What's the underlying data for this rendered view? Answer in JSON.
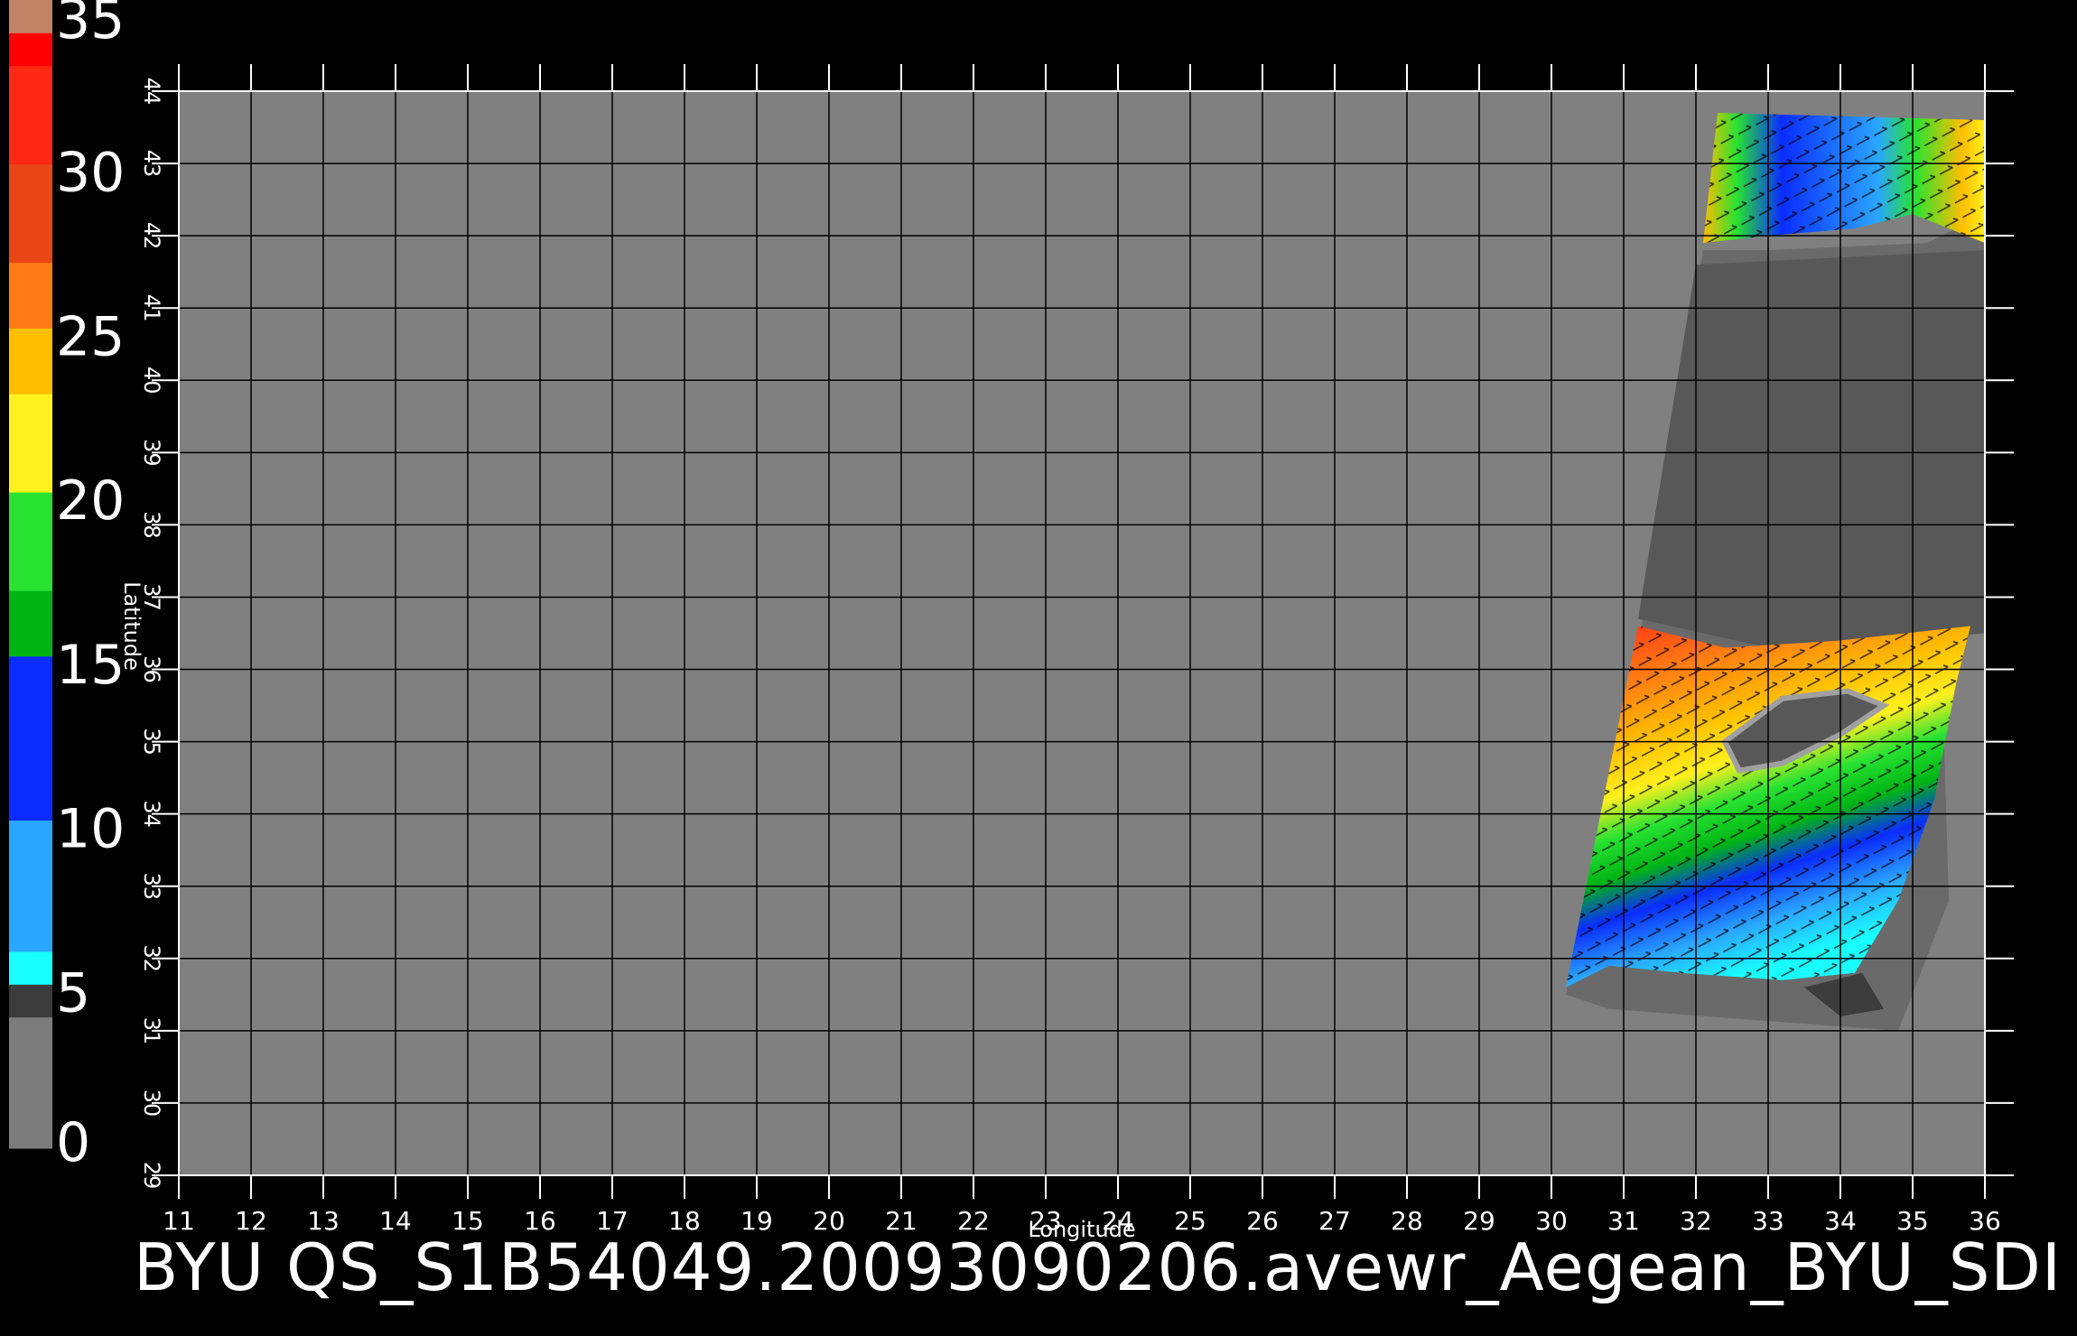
{
  "footer": {
    "title": "BYU  QS_S1B54049.20093090206.avewr_Aegean_BYU_SDI"
  },
  "chart_data": {
    "type": "heatmap",
    "xlabel": "Longitude",
    "ylabel": "Latitude",
    "xlim": [
      11,
      36
    ],
    "ylim": [
      29,
      44
    ],
    "xticks": [
      11,
      12,
      13,
      14,
      15,
      16,
      17,
      18,
      19,
      20,
      21,
      22,
      23,
      24,
      25,
      26,
      27,
      28,
      29,
      30,
      31,
      32,
      33,
      34,
      35,
      36
    ],
    "yticks": [
      29,
      30,
      31,
      32,
      33,
      34,
      35,
      36,
      37,
      38,
      39,
      40,
      41,
      42,
      43,
      44
    ],
    "grid": true,
    "colorbar": {
      "ticks": [
        0,
        5,
        10,
        15,
        20,
        25,
        30,
        35
      ],
      "range": [
        0,
        35
      ],
      "bands": [
        {
          "from": 0,
          "to": 4,
          "color": "#7c7c7c"
        },
        {
          "from": 4,
          "to": 5,
          "color": "#3c3c3c"
        },
        {
          "from": 5,
          "to": 6,
          "color": "#19ffff"
        },
        {
          "from": 6,
          "to": 10,
          "color": "#2aa6ff"
        },
        {
          "from": 10,
          "to": 15,
          "color": "#0a2cff"
        },
        {
          "from": 15,
          "to": 17,
          "color": "#00b414"
        },
        {
          "from": 17,
          "to": 20,
          "color": "#28e232"
        },
        {
          "from": 20,
          "to": 23,
          "color": "#fff01e"
        },
        {
          "from": 23,
          "to": 25,
          "color": "#ffbe00"
        },
        {
          "from": 25,
          "to": 27,
          "color": "#ff7a14"
        },
        {
          "from": 27,
          "to": 30,
          "color": "#e84614"
        },
        {
          "from": 30,
          "to": 33,
          "color": "#ff2814"
        },
        {
          "from": 33,
          "to": 34,
          "color": "#ff0000"
        },
        {
          "from": 34,
          "to": 35,
          "color": "#c08264"
        }
      ]
    },
    "colors": {
      "no_data": "#808080",
      "land": "#585858",
      "coast": "#a0a0a0",
      "grid": "#000000",
      "text": "#ffffff"
    }
  }
}
